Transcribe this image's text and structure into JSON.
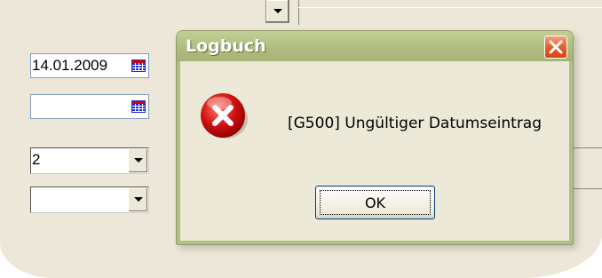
{
  "background_form": {
    "date_field_value": "14.01.2009",
    "date_field_2_value": "",
    "select_1_value": "2",
    "select_2_value": ""
  },
  "dialog": {
    "title": "Logbuch",
    "message": "[G500] Ungültiger Datumseintrag",
    "ok_label": "OK",
    "icon": "error-icon",
    "close_icon": "close-icon"
  },
  "colors": {
    "dialog_frame": "#b1be86",
    "close_button": "#e25a28",
    "dialog_body": "#ece9d8",
    "error_red": "#d01010"
  }
}
